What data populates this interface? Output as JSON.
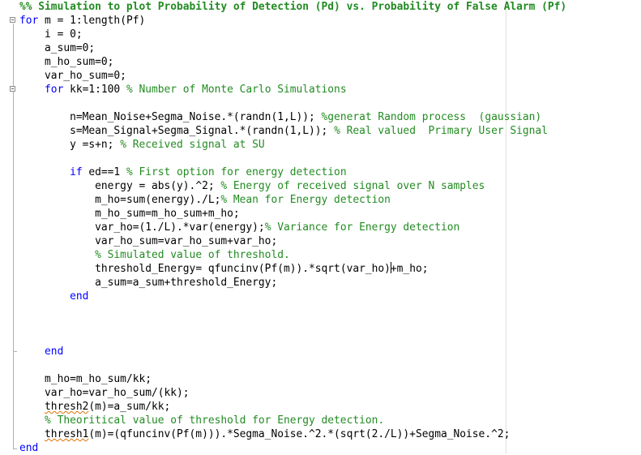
{
  "editor": {
    "lines": [
      {
        "indent": "",
        "segments": [
          {
            "t": "%% Simulation to plot Probability of Detection (Pd) vs. Probability of False Alarm (Pf)",
            "c": "cell-title"
          }
        ]
      },
      {
        "indent": "",
        "segments": [
          {
            "t": "for",
            "c": "kw"
          },
          {
            "t": " m = 1:length(Pf)",
            "c": ""
          }
        ]
      },
      {
        "indent": "    ",
        "segments": [
          {
            "t": "i = 0;",
            "c": ""
          }
        ]
      },
      {
        "indent": "    ",
        "segments": [
          {
            "t": "a_sum=0;",
            "c": ""
          }
        ]
      },
      {
        "indent": "    ",
        "segments": [
          {
            "t": "m_ho_sum=0;",
            "c": ""
          }
        ]
      },
      {
        "indent": "    ",
        "segments": [
          {
            "t": "var_ho_sum=0;",
            "c": ""
          }
        ]
      },
      {
        "indent": "    ",
        "segments": [
          {
            "t": "for",
            "c": "kw"
          },
          {
            "t": " kk=1:100 ",
            "c": ""
          },
          {
            "t": "% Number of Monte Carlo Simulations",
            "c": "cm"
          }
        ]
      },
      {
        "indent": "",
        "segments": []
      },
      {
        "indent": "        ",
        "segments": [
          {
            "t": "n=Mean_Noise+Segma_Noise.*(randn(1,L)); ",
            "c": ""
          },
          {
            "t": "%generat Random process  (gaussian)",
            "c": "cm"
          }
        ]
      },
      {
        "indent": "        ",
        "segments": [
          {
            "t": "s=Mean_Signal+Segma_Signal.*(randn(1,L)); ",
            "c": ""
          },
          {
            "t": "% Real valued  Primary User Signal",
            "c": "cm"
          }
        ]
      },
      {
        "indent": "        ",
        "segments": [
          {
            "t": "y =s+n; ",
            "c": ""
          },
          {
            "t": "% Received signal at SU",
            "c": "cm"
          }
        ]
      },
      {
        "indent": "",
        "segments": []
      },
      {
        "indent": "        ",
        "segments": [
          {
            "t": "if",
            "c": "kw"
          },
          {
            "t": " ed==1 ",
            "c": ""
          },
          {
            "t": "% First option for energy detection",
            "c": "cm"
          }
        ]
      },
      {
        "indent": "            ",
        "segments": [
          {
            "t": "energy = abs(y).^2; ",
            "c": ""
          },
          {
            "t": "% Energy of received signal over N samples",
            "c": "cm"
          }
        ]
      },
      {
        "indent": "            ",
        "segments": [
          {
            "t": "m_ho=sum(energy)./L;",
            "c": ""
          },
          {
            "t": "% Mean for Energy detection",
            "c": "cm"
          }
        ]
      },
      {
        "indent": "            ",
        "segments": [
          {
            "t": "m_ho_sum=m_ho_sum+m_ho;",
            "c": ""
          }
        ]
      },
      {
        "indent": "            ",
        "segments": [
          {
            "t": "var_ho=(1./L).*var(energy);",
            "c": ""
          },
          {
            "t": "% Variance for Energy detection",
            "c": "cm"
          }
        ]
      },
      {
        "indent": "            ",
        "segments": [
          {
            "t": "var_ho_sum=var_ho_sum+var_ho;",
            "c": ""
          }
        ]
      },
      {
        "indent": "            ",
        "segments": [
          {
            "t": "% Simulated value of threshold.",
            "c": "cm"
          }
        ]
      },
      {
        "indent": "            ",
        "segments": [
          {
            "t": "threshold_Energy= qfuncinv(Pf(m)).*sqrt(var_ho)",
            "c": ""
          },
          {
            "t": "",
            "c": "caret"
          },
          {
            "t": "+m_ho;",
            "c": ""
          }
        ]
      },
      {
        "indent": "            ",
        "segments": [
          {
            "t": "a_sum=a_sum+threshold_Energy;",
            "c": ""
          }
        ]
      },
      {
        "indent": "        ",
        "segments": [
          {
            "t": "end",
            "c": "kw"
          }
        ]
      },
      {
        "indent": "",
        "segments": []
      },
      {
        "indent": "",
        "segments": []
      },
      {
        "indent": "",
        "segments": []
      },
      {
        "indent": "    ",
        "segments": [
          {
            "t": "end",
            "c": "kw"
          }
        ]
      },
      {
        "indent": "",
        "segments": []
      },
      {
        "indent": "    ",
        "segments": [
          {
            "t": "m_ho=m_ho_sum/kk;",
            "c": ""
          }
        ]
      },
      {
        "indent": "    ",
        "segments": [
          {
            "t": "var_ho=var_ho_sum/(kk);",
            "c": ""
          }
        ]
      },
      {
        "indent": "    ",
        "segments": [
          {
            "t": "thresh2",
            "c": "ul"
          },
          {
            "t": "(m)=a_sum/kk;",
            "c": ""
          }
        ]
      },
      {
        "indent": "    ",
        "segments": [
          {
            "t": "% Theoritical value of threshold for Energy detection.",
            "c": "cm"
          }
        ]
      },
      {
        "indent": "    ",
        "segments": [
          {
            "t": "thresh1",
            "c": "ul"
          },
          {
            "t": "(m)=(qfuncinv(Pf(m))).*Segma_Noise.^2.*(sqrt(2./L))+Segma_Noise.^2;",
            "c": ""
          }
        ]
      },
      {
        "indent": "",
        "segments": [
          {
            "t": "end",
            "c": "kw"
          }
        ]
      }
    ]
  }
}
